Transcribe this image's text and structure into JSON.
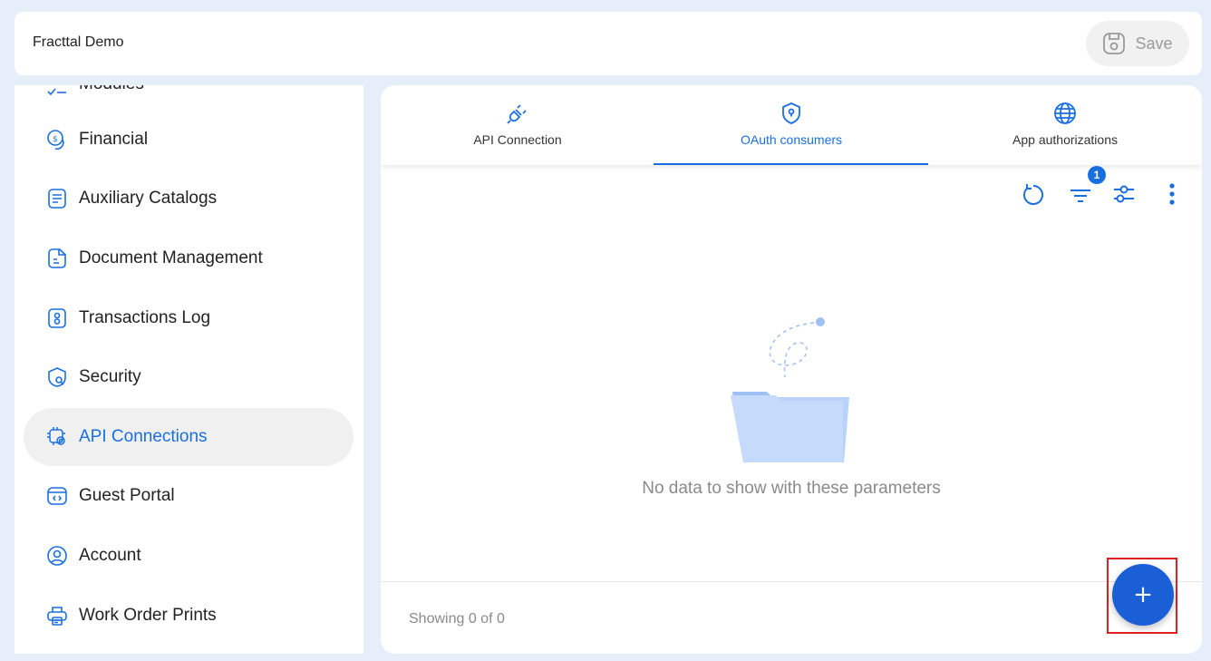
{
  "header": {
    "app_title": "Fracttal Demo",
    "save_label": "Save"
  },
  "sidebar": {
    "items": [
      {
        "label": "Modules",
        "icon": "checklist-icon"
      },
      {
        "label": "Financial",
        "icon": "coins-icon"
      },
      {
        "label": "Auxiliary Catalogs",
        "icon": "catalog-icon"
      },
      {
        "label": "Document Management",
        "icon": "document-icon"
      },
      {
        "label": "Transactions Log",
        "icon": "log-icon"
      },
      {
        "label": "Security",
        "icon": "shield-icon"
      },
      {
        "label": "API Connections",
        "icon": "gear-chip-icon",
        "active": true
      },
      {
        "label": "Guest Portal",
        "icon": "browser-code-icon"
      },
      {
        "label": "Account",
        "icon": "user-circle-icon"
      },
      {
        "label": "Work Order Prints",
        "icon": "printer-icon"
      }
    ]
  },
  "tabs": [
    {
      "label": "API Connection",
      "icon": "plug-icon"
    },
    {
      "label": "OAuth consumers",
      "icon": "shield-key-icon",
      "active": true
    },
    {
      "label": "App authorizations",
      "icon": "globe-icon"
    }
  ],
  "toolbar": {
    "filter_badge": "1"
  },
  "empty_state": {
    "message": "No data to show with these parameters"
  },
  "footer": {
    "showing": "Showing 0 of 0"
  },
  "fab": {
    "label": "+"
  },
  "colors": {
    "accent": "#1a6fe0",
    "fab": "#1a5fd6",
    "background": "#e6eef9"
  }
}
